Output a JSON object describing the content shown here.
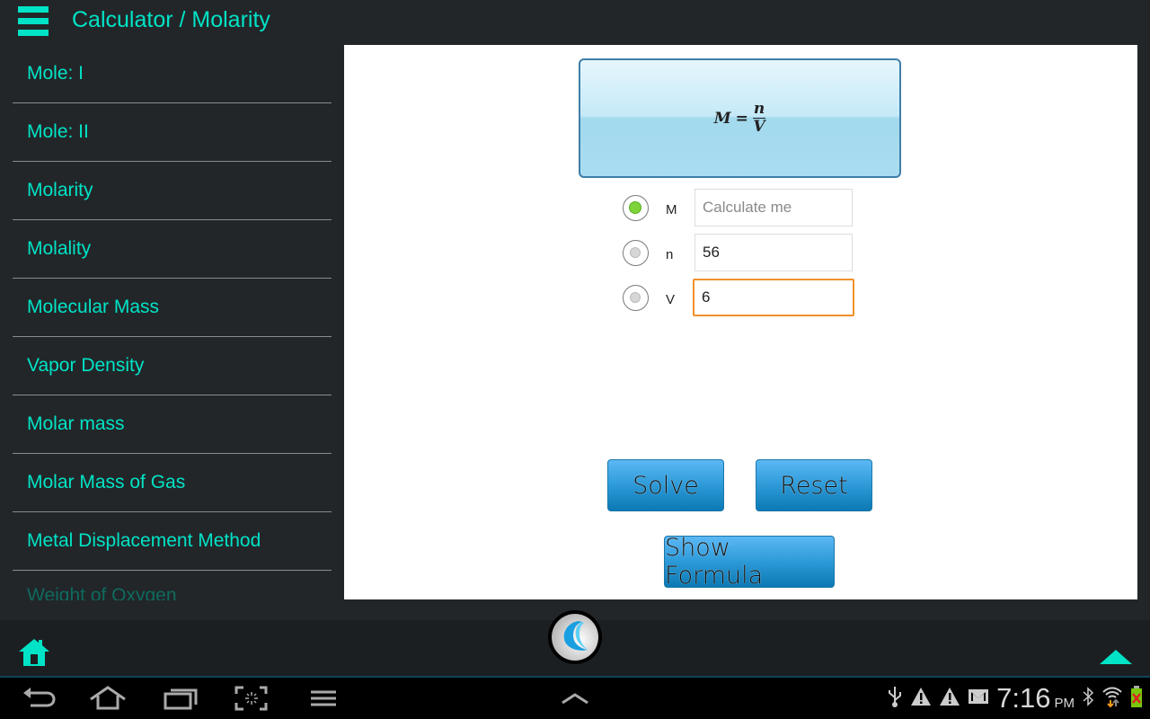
{
  "header": {
    "title": "Calculator / Molarity"
  },
  "sidebar": {
    "items": [
      {
        "label": "Mole: I"
      },
      {
        "label": "Mole: II"
      },
      {
        "label": "Molarity"
      },
      {
        "label": "Molality"
      },
      {
        "label": "Molecular Mass"
      },
      {
        "label": "Vapor Density"
      },
      {
        "label": "Molar mass"
      },
      {
        "label": "Molar Mass of Gas"
      },
      {
        "label": "Metal Displacement Method"
      },
      {
        "label": "Weight of Oxygen"
      }
    ]
  },
  "formula": {
    "lhs": "M",
    "equals": "=",
    "numerator": "n",
    "denominator": "V"
  },
  "inputs": [
    {
      "variable": "M",
      "value": "",
      "placeholder": "Calculate me",
      "selected": true
    },
    {
      "variable": "n",
      "value": "56",
      "placeholder": "",
      "selected": false
    },
    {
      "variable": "V",
      "value": "6",
      "placeholder": "",
      "selected": false,
      "focused": true
    }
  ],
  "buttons": {
    "solve": "Solve",
    "reset": "Reset",
    "show_formula": "Show Formula"
  },
  "statusbar": {
    "time": "7:16",
    "ampm": "PM",
    "icons": [
      "usb-icon",
      "warning-icon",
      "warning-icon",
      "gmail-icon",
      "bluetooth-icon",
      "wifi-icon",
      "battery-icon"
    ]
  },
  "colors": {
    "accent": "#00e3c6",
    "background": "#222629",
    "button_blue": "#2d9ad8",
    "focus_orange": "#f1902a",
    "radio_selected": "#7fd33a"
  }
}
